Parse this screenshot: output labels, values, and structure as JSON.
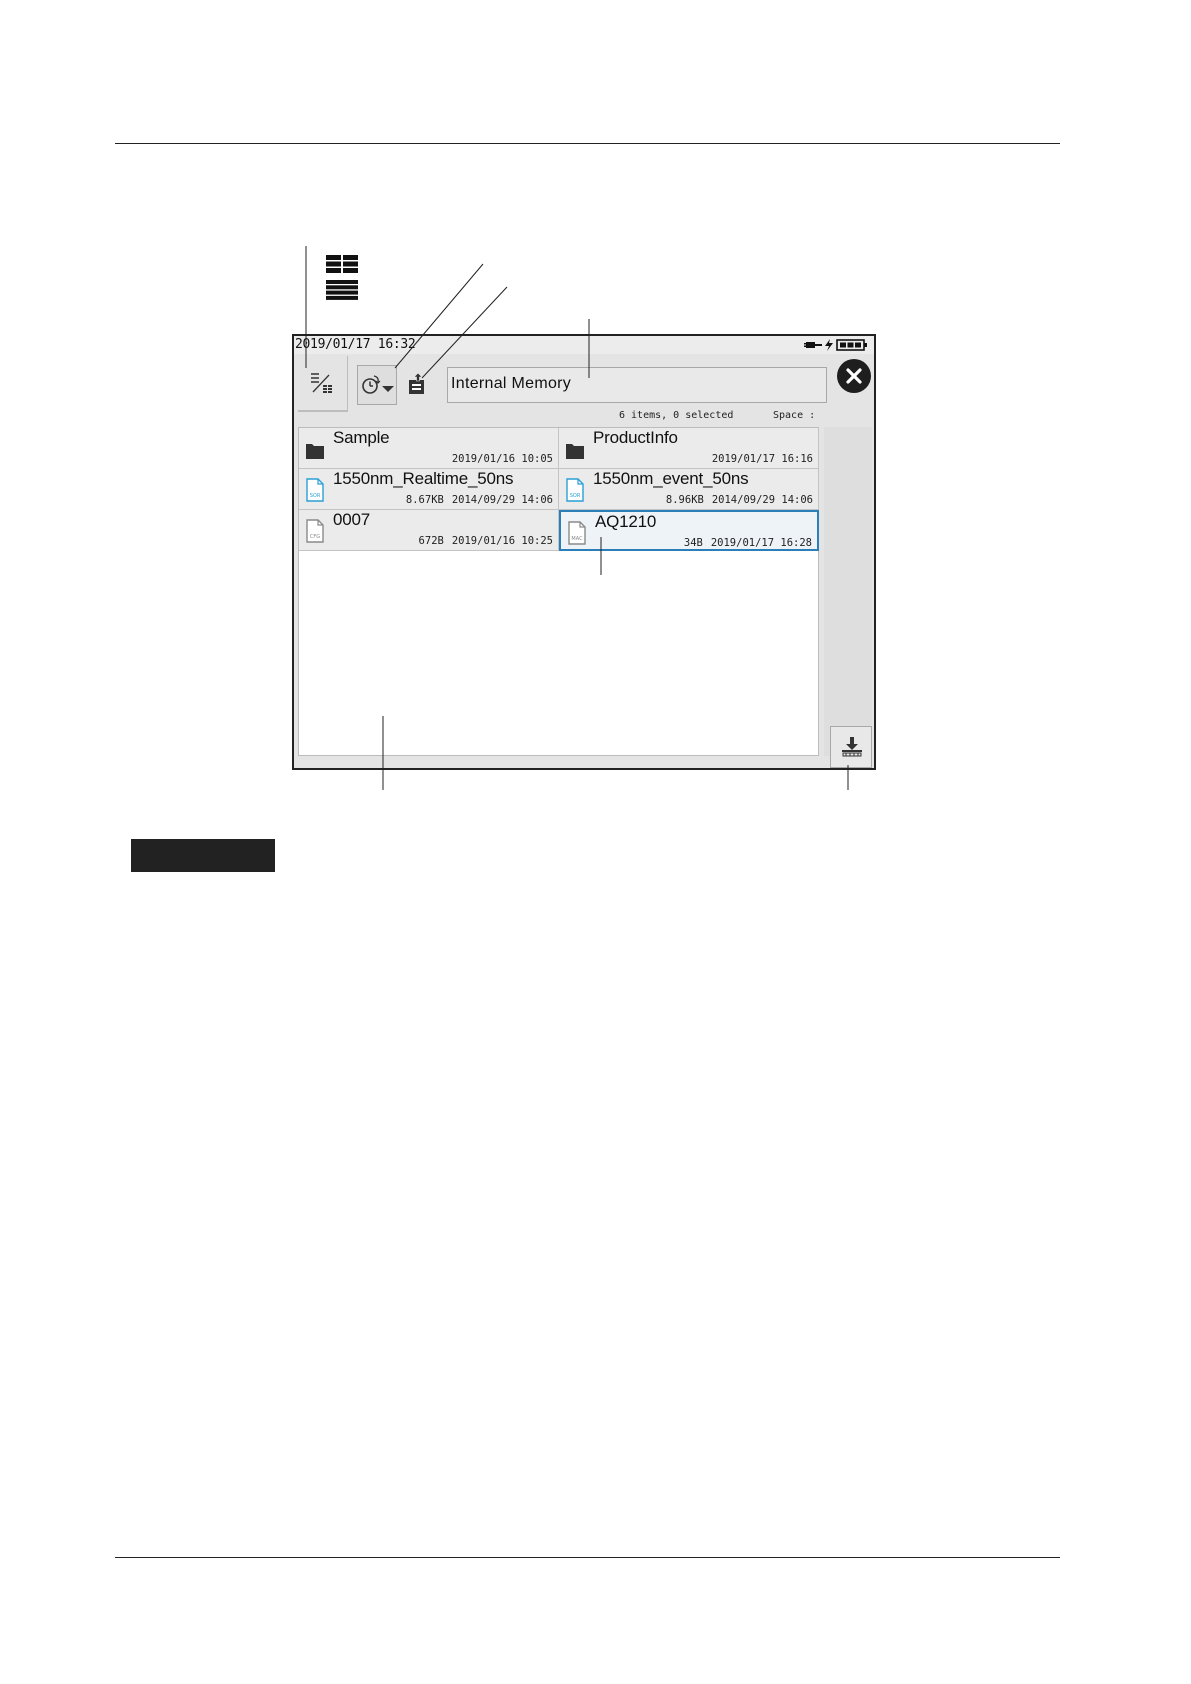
{
  "statusbar": {
    "clock": "2019/01/17 16:32",
    "power_icon": "battery-charging-icon"
  },
  "toolbar": {
    "view_toggle_icon": "view-mode-icon",
    "sort_icon": "clock-sort-icon",
    "up_folder_icon": "parent-folder-icon",
    "path": "Internal Memory",
    "close_icon": "close-icon"
  },
  "info": {
    "count": "6 items, 0 selected",
    "space_label": "Space :"
  },
  "files": [
    {
      "name": "Sample",
      "type": "folder",
      "size": "",
      "date": "2019/01/16 10:05",
      "icon": "folder-icon",
      "selected": false
    },
    {
      "name": "ProductInfo",
      "type": "folder",
      "size": "",
      "date": "2019/01/17 16:16",
      "icon": "folder-icon",
      "selected": false
    },
    {
      "name": "1550nm_Realtime_50ns",
      "type": "sor",
      "size": "8.67KB",
      "date": "2014/09/29 14:06",
      "icon": "sor-file-icon",
      "selected": false
    },
    {
      "name": "1550nm_event_50ns",
      "type": "sor",
      "size": "8.96KB",
      "date": "2014/09/29 14:06",
      "icon": "sor-file-icon",
      "selected": false
    },
    {
      "name": "0007",
      "type": "cfg",
      "size": "672B",
      "date": "2019/01/16 10:25",
      "icon": "cfg-file-icon",
      "selected": false
    },
    {
      "name": "AQ1210",
      "type": "mac",
      "size": "34B",
      "date": "2019/01/17 16:28",
      "icon": "mac-file-icon",
      "selected": true
    }
  ],
  "save_button_icon": "save-to-icon",
  "colors": {
    "selection": "#2b7fb8",
    "sor_icon": "#2a9fd4",
    "panel": "#e4e4e4"
  }
}
